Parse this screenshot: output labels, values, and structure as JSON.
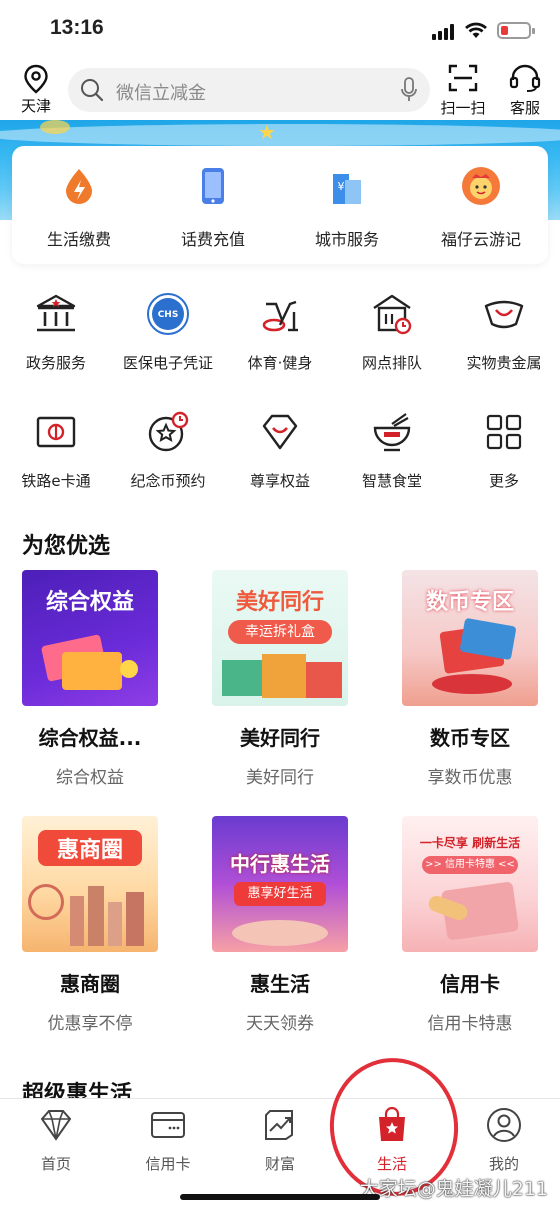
{
  "status": {
    "time": "13:16"
  },
  "header": {
    "location": "天津",
    "search_placeholder": "微信立减金",
    "scan_label": "扫一扫",
    "service_label": "客服"
  },
  "top_services": [
    {
      "label": "生活缴费",
      "icon": "water-drop-icon"
    },
    {
      "label": "话费充值",
      "icon": "phone-icon"
    },
    {
      "label": "城市服务",
      "icon": "building-icon"
    },
    {
      "label": "福仔云游记",
      "icon": "mascot-icon"
    }
  ],
  "grid": [
    {
      "label": "政务服务",
      "icon": "government-icon"
    },
    {
      "label": "医保电子凭证",
      "icon": "chs-icon",
      "badge": "CHS"
    },
    {
      "label": "体育·健身",
      "icon": "fitness-bike-icon"
    },
    {
      "label": "网点排队",
      "icon": "branch-queue-icon"
    },
    {
      "label": "实物贵金属",
      "icon": "gold-ingot-icon"
    },
    {
      "label": "铁路e卡通",
      "icon": "railway-card-icon"
    },
    {
      "label": "纪念币预约",
      "icon": "coin-reserve-icon"
    },
    {
      "label": "尊享权益",
      "icon": "diamond-smile-icon"
    },
    {
      "label": "智慧食堂",
      "icon": "bowl-icon"
    },
    {
      "label": "更多",
      "icon": "more-grid-icon"
    }
  ],
  "section_title": "为您优选",
  "promos": [
    {
      "title": "综合权益...",
      "sub": "综合权益",
      "img_text": "综合权益"
    },
    {
      "title": "美好同行",
      "sub": "美好同行",
      "img_text": "美好同行",
      "img_sub": "幸运拆礼盒"
    },
    {
      "title": "数币专区",
      "sub": "享数币优惠",
      "img_text": "数币专区"
    },
    {
      "title": "惠商圈",
      "sub": "优惠享不停",
      "img_text": "惠商圈"
    },
    {
      "title": "惠生活",
      "sub": "天天领券",
      "img_text": "中行惠生活",
      "img_sub": "惠享好生活"
    },
    {
      "title": "信用卡",
      "sub": "信用卡特惠",
      "img_text": "一卡尽享 刷新生活",
      "img_sub": ">> 信用卡特惠 <<"
    }
  ],
  "section2_title": "超级惠生活",
  "tabs": [
    {
      "label": "首页",
      "icon": "diamond-icon"
    },
    {
      "label": "信用卡",
      "icon": "credit-card-icon"
    },
    {
      "label": "财富",
      "icon": "wealth-chart-icon"
    },
    {
      "label": "生活",
      "icon": "shopping-bag-icon",
      "active": true
    },
    {
      "label": "我的",
      "icon": "profile-icon"
    }
  ],
  "watermark": "大家坛@鬼娃凝儿211",
  "colors": {
    "accent": "#d4222a",
    "banner": "#37b8f2"
  }
}
